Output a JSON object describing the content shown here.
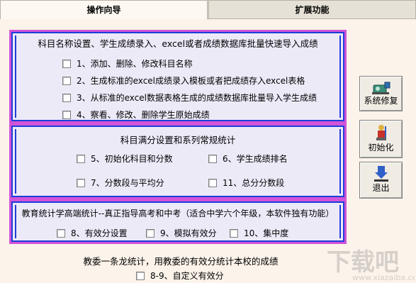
{
  "tabs": [
    {
      "label": "操作向导",
      "active": true
    },
    {
      "label": "扩展功能",
      "active": false
    }
  ],
  "section1": {
    "title": "科目名称设置、学生成绩录入、excel或者成绩数据库批量快速导入成绩",
    "options": [
      "1、添加、删除、修改科目名称",
      "2、生成标准的excel成绩录入模板或者把成绩存入excel表格",
      "3、从标准的excel数据表格生成的成绩数据库批量导入学生成绩",
      "4、察看、修改、删除学生原始成绩"
    ]
  },
  "section2": {
    "title": "科目满分设置和系列常规统计",
    "options": [
      "5、初始化科目和分数",
      "6、学生成绩排名",
      "7、分数段与平均分",
      "11、总分分数段"
    ]
  },
  "section3": {
    "title": "教育统计学高端统计--真正指导高考和中考（适合中学六个年级，本软件独有功能）",
    "options": [
      "8、有效分设置",
      "9、模拟有效分",
      "10、集中度"
    ]
  },
  "section4": {
    "title": "教委一条龙统计，用教委的有效分统计本校的成绩",
    "options": [
      "8-9、自定义有效分"
    ]
  },
  "side_buttons": [
    {
      "label": "系统修复",
      "icon": "system-repair-icon"
    },
    {
      "label": "初始化",
      "icon": "initialize-icon"
    },
    {
      "label": "退出",
      "icon": "exit-icon"
    }
  ],
  "colors": {
    "panel_border_outer": "#d154d8",
    "panel_border_inner": "#1d3fd8",
    "panel_bg": "#edeaf8"
  }
}
